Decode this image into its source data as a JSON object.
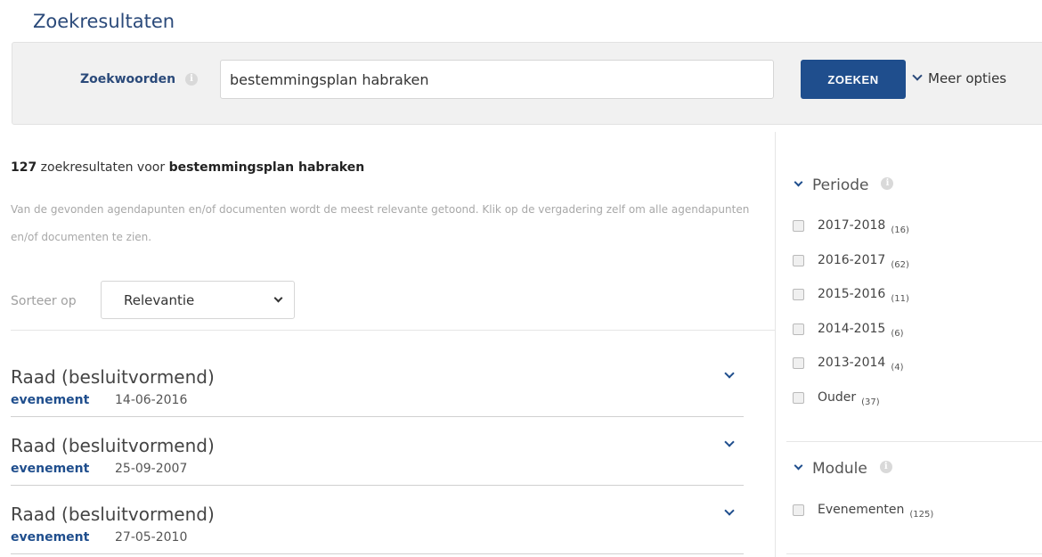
{
  "page": {
    "title": "Zoekresultaten"
  },
  "search": {
    "label": "Zoekwoorden",
    "value": "bestemmingsplan habraken",
    "button": "ZOEKEN",
    "more_options": "Meer opties"
  },
  "summary": {
    "count": "127",
    "text": " zoekresultaten voor ",
    "query": "bestemmingsplan habraken",
    "hint": "Van de gevonden agendapunten en/of documenten wordt de meest relevante getoond. Klik op de vergadering zelf om alle agendapunten en/of documenten te zien."
  },
  "sort": {
    "label": "Sorteer op",
    "value": "Relevantie"
  },
  "results": [
    {
      "title": "Raad (besluitvormend)",
      "type": "evenement",
      "date": "14-06-2016"
    },
    {
      "title": "Raad (besluitvormend)",
      "type": "evenement",
      "date": "25-09-2007"
    },
    {
      "title": "Raad (besluitvormend)",
      "type": "evenement",
      "date": "27-05-2010"
    }
  ],
  "facets": {
    "periode": {
      "title": "Periode",
      "items": [
        {
          "label": "2017-2018",
          "count": "(16)"
        },
        {
          "label": "2016-2017",
          "count": "(62)"
        },
        {
          "label": "2015-2016",
          "count": "(11)"
        },
        {
          "label": "2014-2015",
          "count": "(6)"
        },
        {
          "label": "2013-2014",
          "count": "(4)"
        },
        {
          "label": "Ouder",
          "count": "(37)"
        }
      ]
    },
    "module": {
      "title": "Module",
      "items": [
        {
          "label": "Evenementen",
          "count": "(125)"
        }
      ]
    }
  },
  "colors": {
    "primary": "#1f4e8d",
    "title": "#2b4a7a"
  },
  "icons": {
    "info": "info-icon",
    "chevron": "chevron-down-icon"
  }
}
